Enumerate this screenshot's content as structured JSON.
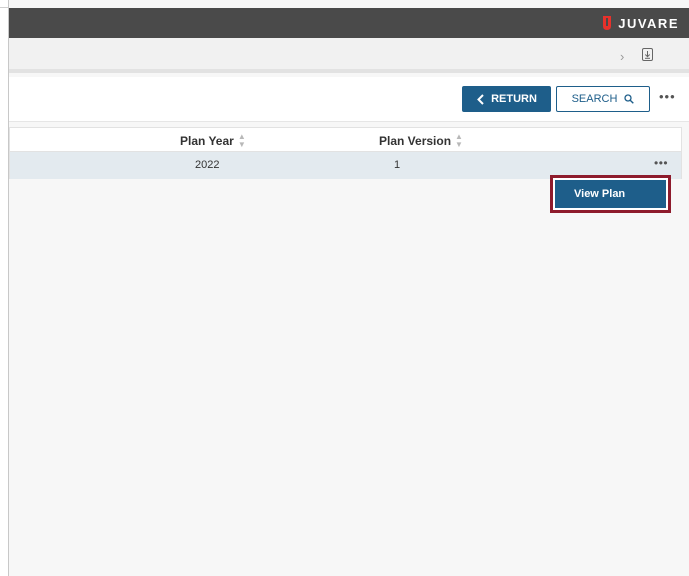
{
  "brand": {
    "name": "JUVARE",
    "logo_color": "#e8312b"
  },
  "subbar": {
    "chevron_icon": "chevron-right-icon",
    "doc_icon": "export-document-icon"
  },
  "toolbar": {
    "return_label": "RETURN",
    "search_label": "SEARCH",
    "more_label": "•••"
  },
  "grid": {
    "columns": [
      {
        "label": "Plan Year"
      },
      {
        "label": "Plan Version"
      }
    ],
    "rows": [
      {
        "plan_year": "2022",
        "plan_version": "1",
        "more": "•••"
      }
    ]
  },
  "context_menu": {
    "items": [
      {
        "label": "View Plan"
      }
    ]
  },
  "colors": {
    "topbar": "#4a4a4a",
    "primary": "#1e5e8a",
    "highlight_border": "#8e1b2c",
    "selected_row": "#e3eaef"
  }
}
